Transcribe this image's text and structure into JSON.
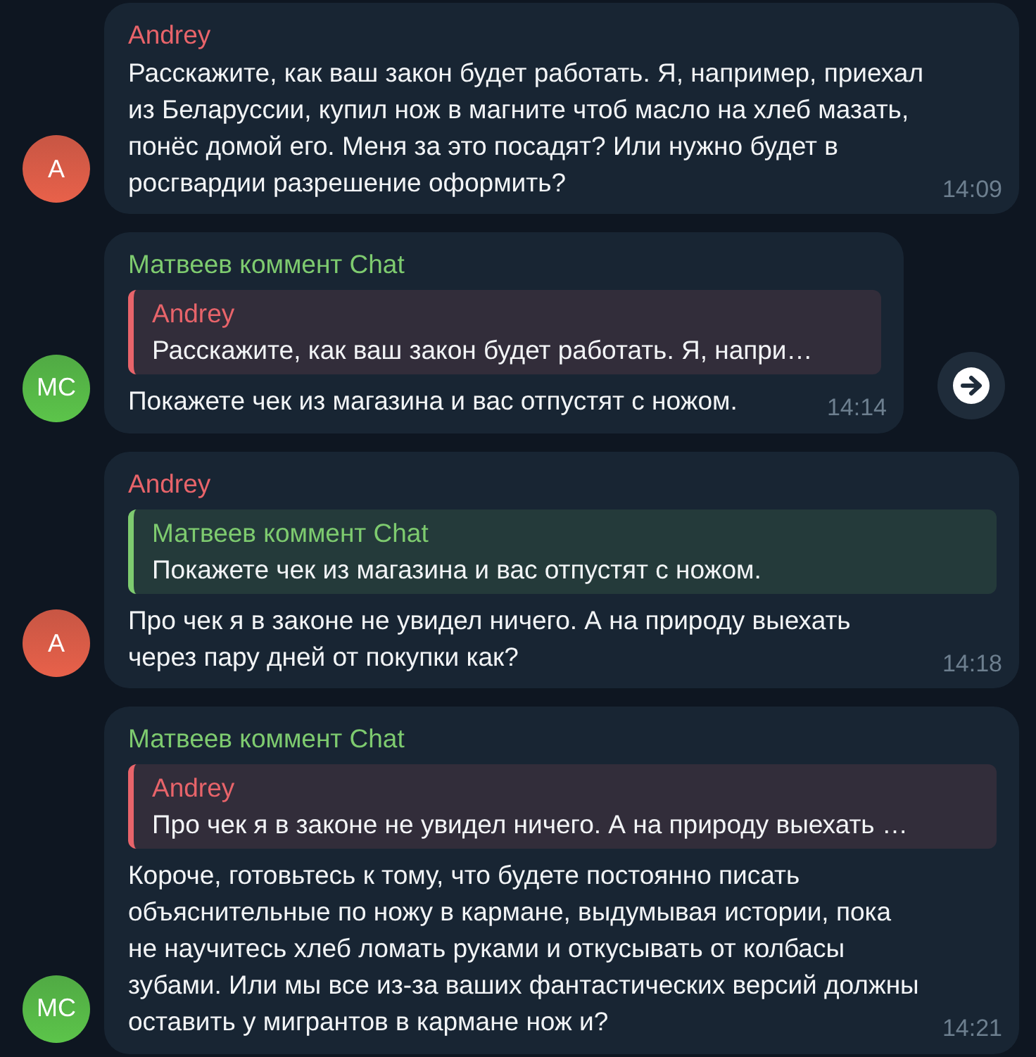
{
  "messages": [
    {
      "sender": "Andrey",
      "color": "#e8646a",
      "avatar": {
        "initials": "A",
        "color": "#e8614a"
      },
      "text": "Расскажите, как ваш закон будет работать. Я, например, приехал из Беларуссии, купил нож в магните чтоб масло на хлеб мазать, понёс домой его. Меня за это посадят? Или нужно будет в росгвардии разрешение оформить?",
      "time": "14:09",
      "share_button": false
    },
    {
      "sender": "Матвеев коммент Chat",
      "color": "#7ecb6f",
      "avatar": {
        "initials": "MC",
        "color": "#5cc44a"
      },
      "reply": {
        "sender": "Andrey",
        "color": "#e8646a",
        "text": "Расскажите, как ваш закон будет работать. Я, напри…"
      },
      "text": "Покажете чек из магазина и вас отпустят с ножом.",
      "time": "14:14",
      "share_button": true
    },
    {
      "sender": "Andrey",
      "color": "#e8646a",
      "avatar": {
        "initials": "A",
        "color": "#e8614a"
      },
      "reply": {
        "sender": "Матвеев коммент Chat",
        "color": "#7ecb6f",
        "text": "Покажете чек из магазина и вас отпустят с ножом."
      },
      "text": "Про чек я в законе не увидел ничего. А на природу выехать через пару дней от покупки как?",
      "time": "14:18",
      "share_button": false
    },
    {
      "sender": "Матвеев коммент Chat",
      "color": "#7ecb6f",
      "avatar": {
        "initials": "MC",
        "color": "#5cc44a"
      },
      "reply": {
        "sender": "Andrey",
        "color": "#e8646a",
        "text": "Про чек я в законе не увидел ничего. А на природу выехать …"
      },
      "text": "Короче, готовьтесь к тому, что будете постоянно писать объяснительные по ножу в кармане, выдумывая истории, пока не научитесь хлеб ломать руками и откусывать от колбасы зубами. Или мы все из-за ваших фантастических версий должны оставить у мигрантов в кармане нож и?",
      "time": "14:21",
      "share_button": false
    }
  ]
}
